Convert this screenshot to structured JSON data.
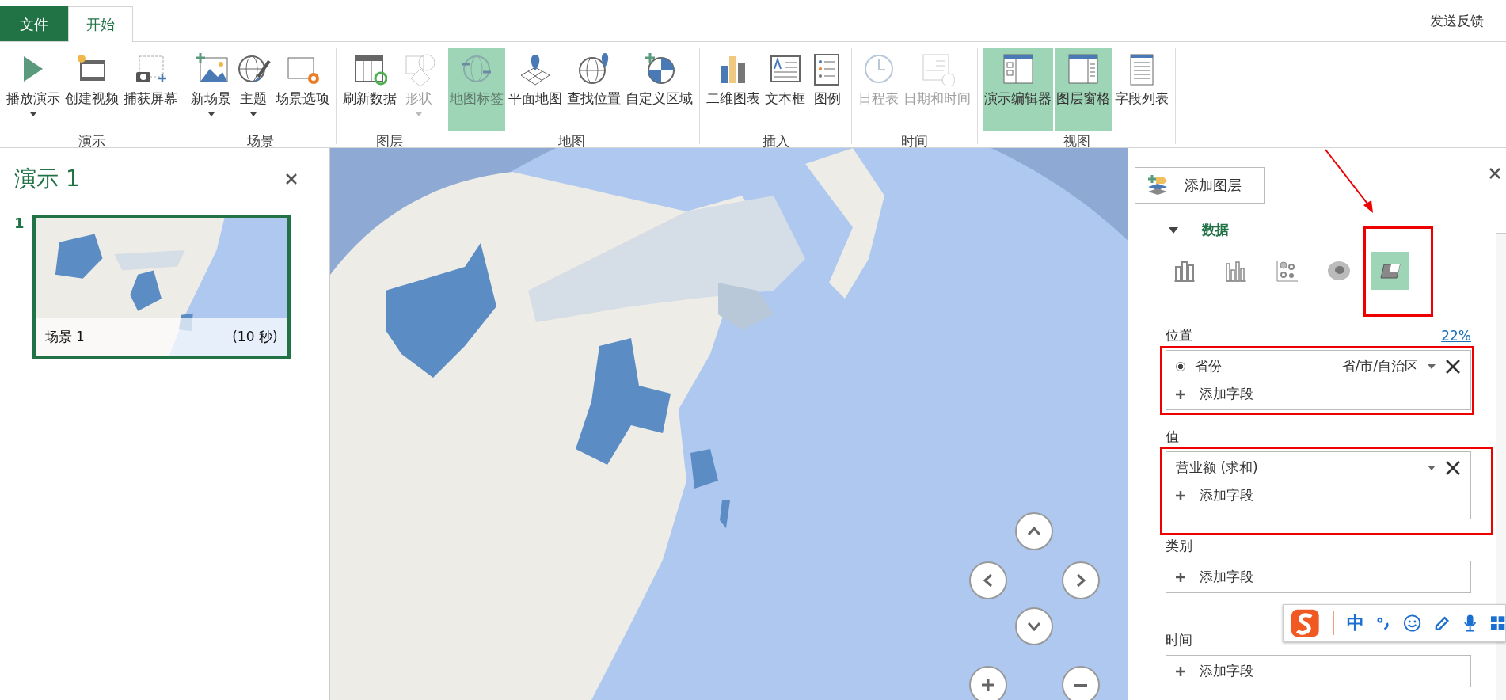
{
  "tabs": [
    {
      "label": "文件",
      "kind": "file",
      "selected": false
    },
    {
      "label": "开始",
      "kind": "tab",
      "selected": true
    }
  ],
  "feedback": "发送反馈",
  "ribbon_groups": [
    {
      "label": "演示",
      "buttons": [
        {
          "label": "播放演示",
          "kind": "play",
          "dropdown": true,
          "disabled": false,
          "on": false
        },
        {
          "label": "创建视频",
          "kind": "video",
          "dropdown": false,
          "disabled": false,
          "on": false
        },
        {
          "label": "捕获屏幕",
          "kind": "capture",
          "dropdown": false,
          "disabled": false,
          "on": false
        }
      ]
    },
    {
      "label": "场景",
      "buttons": [
        {
          "label": "新场景",
          "kind": "new-scene",
          "dropdown": true,
          "disabled": false,
          "on": false
        },
        {
          "label": "主题",
          "kind": "theme",
          "dropdown": true,
          "disabled": false,
          "on": false
        },
        {
          "label": "场景选项",
          "kind": "scene-options",
          "dropdown": false,
          "disabled": false,
          "on": false
        }
      ]
    },
    {
      "label": "图层",
      "buttons": [
        {
          "label": "刷新数据",
          "kind": "refresh",
          "dropdown": false,
          "disabled": false,
          "on": false
        },
        {
          "label": "形状",
          "kind": "shape",
          "dropdown": true,
          "disabled": true,
          "on": false
        }
      ]
    },
    {
      "label": "地图",
      "buttons": [
        {
          "label": "地图标签",
          "kind": "map-labels",
          "dropdown": false,
          "disabled": true,
          "on": true
        },
        {
          "label": "平面地图",
          "kind": "flat-map",
          "dropdown": false,
          "disabled": false,
          "on": false
        },
        {
          "label": "查找位置",
          "kind": "find-location",
          "dropdown": false,
          "disabled": false,
          "on": false
        },
        {
          "label": "自定义区域",
          "kind": "custom-region",
          "dropdown": false,
          "disabled": false,
          "on": false
        }
      ]
    },
    {
      "label": "插入",
      "buttons": [
        {
          "label": "二维图表",
          "kind": "chart",
          "dropdown": false,
          "disabled": false,
          "on": false
        },
        {
          "label": "文本框",
          "kind": "textbox",
          "dropdown": false,
          "disabled": false,
          "on": false
        },
        {
          "label": "图例",
          "kind": "legend",
          "dropdown": false,
          "disabled": false,
          "on": false
        }
      ]
    },
    {
      "label": "时间",
      "buttons": [
        {
          "label": "日程表",
          "kind": "timeline",
          "dropdown": false,
          "disabled": true,
          "on": false
        },
        {
          "label": "日期和时间",
          "kind": "datetime",
          "dropdown": false,
          "disabled": true,
          "on": false
        }
      ]
    },
    {
      "label": "视图",
      "buttons": [
        {
          "label": "演示编辑器",
          "kind": "editor",
          "dropdown": false,
          "disabled": false,
          "on": true
        },
        {
          "label": "图层窗格",
          "kind": "layer-pane",
          "dropdown": false,
          "disabled": false,
          "on": true
        },
        {
          "label": "字段列表",
          "kind": "field-list",
          "dropdown": false,
          "disabled": false,
          "on": false
        }
      ]
    }
  ],
  "tour_pane": {
    "title": "演示 1",
    "scenes": [
      {
        "number": "1",
        "name": "场景 1",
        "duration": "(10 秒)",
        "selected": true
      }
    ]
  },
  "layer_pane": {
    "add_layer": "添加图层",
    "section": {
      "title": "数据",
      "expanded": true
    },
    "chart_types": [
      {
        "kind": "stacked-column",
        "selected": false,
        "annotated": false
      },
      {
        "kind": "clustered-column",
        "selected": false,
        "annotated": false
      },
      {
        "kind": "bubble",
        "selected": false,
        "annotated": false
      },
      {
        "kind": "heat-map",
        "selected": false,
        "annotated": false
      },
      {
        "kind": "region",
        "selected": true,
        "annotated": true
      }
    ],
    "wells": [
      {
        "label": "位置",
        "extra": "22%",
        "annotated": true,
        "fields": [
          {
            "name": "省份",
            "type": "省/市/自治区",
            "checked": true
          }
        ],
        "add": "添加字段"
      },
      {
        "label": "值",
        "annotated": true,
        "fields": [
          {
            "name": "营业额 (求和)"
          }
        ],
        "add": "添加字段"
      },
      {
        "label": "类别",
        "annotated": false,
        "add": "添加字段"
      },
      {
        "label": "时间",
        "annotated": false,
        "add": "添加字段"
      }
    ]
  },
  "ime_toolbar": {
    "mode": "中"
  }
}
